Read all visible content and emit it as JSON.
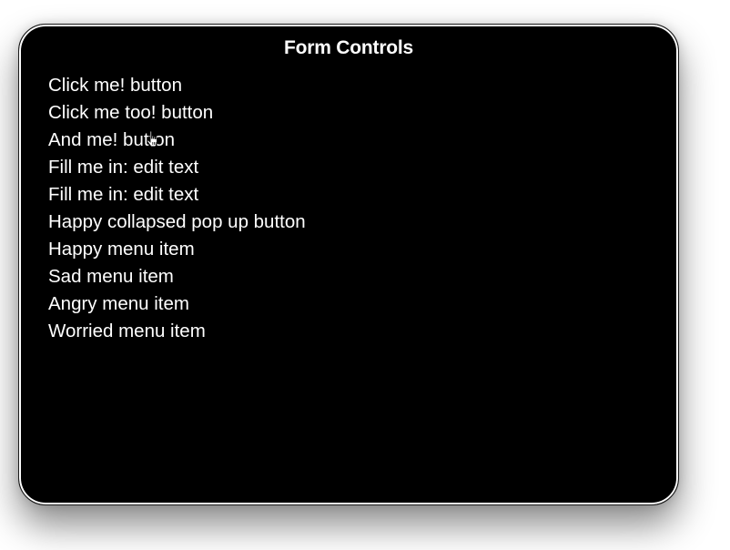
{
  "window": {
    "title": "Form Controls",
    "background_color": "#000000",
    "text_color": "#ffffff",
    "items": [
      {
        "label": "Click me! button",
        "role": "button"
      },
      {
        "label": "Click me too! button",
        "role": "button"
      },
      {
        "label": "And me! button",
        "role": "button"
      },
      {
        "label": "Fill me in: edit text",
        "role": "edit-text"
      },
      {
        "label": "Fill me in: edit text",
        "role": "edit-text"
      },
      {
        "label": "Happy collapsed pop up button",
        "role": "pop-up-button"
      },
      {
        "label": "Happy menu item",
        "role": "menu-item"
      },
      {
        "label": "Sad menu item",
        "role": "menu-item"
      },
      {
        "label": "Angry menu item",
        "role": "menu-item"
      },
      {
        "label": "Worried menu item",
        "role": "menu-item"
      }
    ]
  },
  "cursor": {
    "icon": "pointing-hand-cursor-icon"
  }
}
